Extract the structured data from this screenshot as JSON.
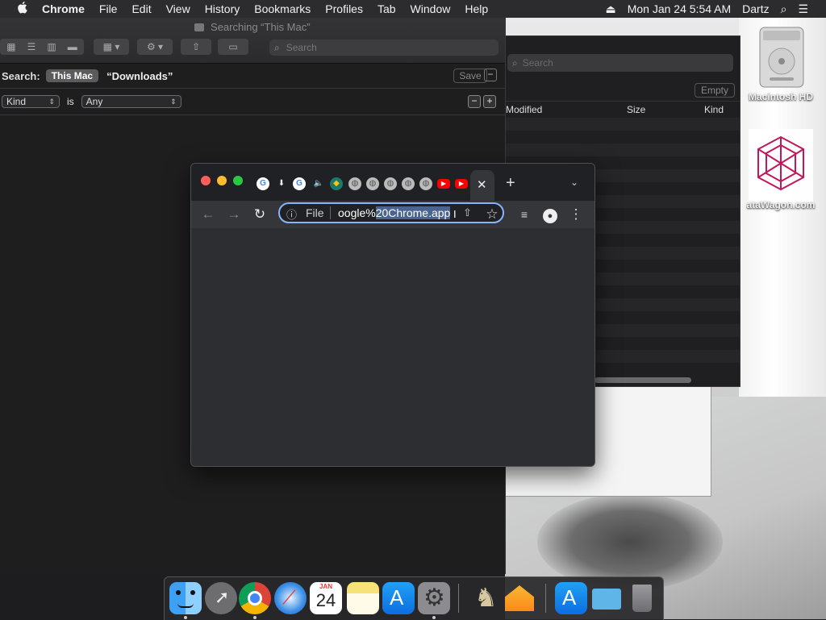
{
  "menubar": {
    "app_name": "Chrome",
    "items": [
      "File",
      "Edit",
      "View",
      "History",
      "Bookmarks",
      "Profiles",
      "Tab",
      "Window",
      "Help"
    ],
    "datetime": "Mon Jan 24  5:54 AM",
    "user": "Dartz"
  },
  "finder": {
    "title": "Searching “This Mac”",
    "search_placeholder": "Search",
    "search_label": "Search:",
    "scope_active": "This Mac",
    "scope_other": "“Downloads”",
    "save_label": "Save",
    "criteria_kind": "Kind",
    "criteria_is": "is",
    "criteria_value": "Any"
  },
  "window2": {
    "search_placeholder": "Search",
    "empty_label": "Empty",
    "columns": [
      "Modified",
      "Size",
      "Kind"
    ]
  },
  "desktop": {
    "icons": [
      {
        "label": "Macintosh HD"
      },
      {
        "label": "ataWagon.com"
      }
    ]
  },
  "chrome": {
    "file_label": "File",
    "url_prefix": "oogle%",
    "url_selected": "20Chrome.app",
    "colors": {
      "accent": "#8ab4f8",
      "close": "#ff5f57",
      "minimize": "#febc2e",
      "zoom": "#28c840"
    }
  },
  "dock": {
    "calendar_month": "JAN",
    "calendar_day": "24"
  }
}
